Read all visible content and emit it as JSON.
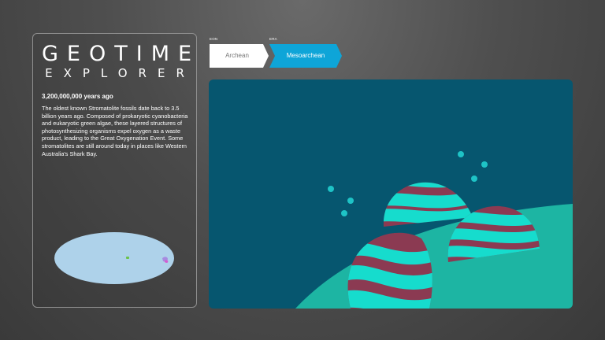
{
  "app": {
    "title": "GEOTIME",
    "subtitle": "EXPLORER"
  },
  "info": {
    "years_ago": "3,200,000,000 years ago",
    "description": "The oldest known Stromatolite fossils date back to 3.5 billion years ago. Composed of prokaryotic cyanobacteria and eukaryotic green algae, these layered structures of photosynthesizing organisms expel oxygen as a waste product, leading to the Great Oxygenation Event. Some stromatolites are still around today in places like Western Australia's Shark Bay."
  },
  "breadcrumb": {
    "eon_caption": "EON",
    "eon_value": "Archean",
    "era_caption": "ERA",
    "era_value": "Mesoarchean"
  },
  "colors": {
    "background": "#4f4f4f",
    "accent": "#0ea5d8",
    "ocean": "#06566f",
    "seafloor": "#1db5a3",
    "stromatolite_band_a": "#8b3a52",
    "stromatolite_band_b": "#16dccd",
    "bubble": "#1ec3c6",
    "map_ocean": "#aed2ea"
  },
  "scene": {
    "subject": "stromatolites",
    "icons": [
      "stromatolite-mound-icon",
      "bubble-icon"
    ]
  }
}
